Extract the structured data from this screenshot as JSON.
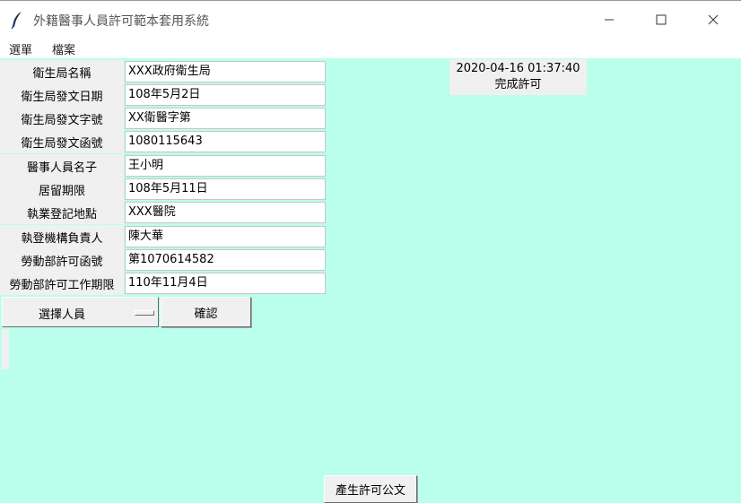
{
  "window": {
    "title": "外籍醫事人員許可範本套用系統"
  },
  "menu": {
    "items": [
      "選單",
      "檔案"
    ]
  },
  "form": {
    "fields": [
      {
        "label": "衛生局名稱",
        "value": "XXX政府衛生局"
      },
      {
        "label": "衛生局發文日期",
        "value": "108年5月2日"
      },
      {
        "label": "衛生局發文字號",
        "value": "XX衛醫字第"
      },
      {
        "label": "衛生局發文函號",
        "value": "1080115643"
      },
      {
        "label": "醫事人員名子",
        "value": "王小明"
      },
      {
        "label": "居留期限",
        "value": "108年5月11日"
      },
      {
        "label": "執業登記地點",
        "value": "XXX醫院"
      },
      {
        "label": "執登機構負責人",
        "value": "陳大華"
      },
      {
        "label": "勞動部許可函號",
        "value": "第1070614582"
      },
      {
        "label": "勞動部許可工作期限",
        "value": "110年11月4日"
      }
    ],
    "select_person": "選擇人員",
    "confirm_button": "確認"
  },
  "status": {
    "timestamp": "2020-04-16 01:37:40",
    "message": "完成許可"
  },
  "generate_button": "產生許可公文",
  "colors": {
    "background": "#baffeb",
    "widget": "#f0f0f0"
  }
}
